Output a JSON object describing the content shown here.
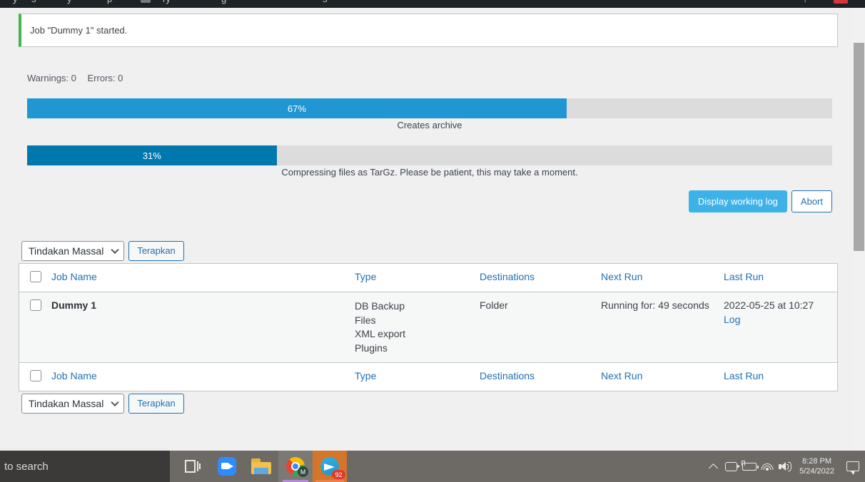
{
  "adminbar": {
    "items": [
      "y",
      "s",
      "y",
      "p",
      "A",
      "ry",
      "g",
      "s",
      "t"
    ],
    "right_item": "?"
  },
  "notice": {
    "message": "Job \"Dummy 1\" started.",
    "accent_color": "#46b450"
  },
  "status": {
    "warnings_label": "Warnings: 0",
    "errors_label": "Errors: 0"
  },
  "progress": {
    "bars": [
      {
        "percent_label": "67%",
        "percent": 67,
        "caption": "Creates archive",
        "color": "#2096d2"
      },
      {
        "percent_label": "31%",
        "percent": 31,
        "caption": "Compressing files as TarGz. Please be patient, this may take a moment.",
        "color": "#0178ad"
      }
    ]
  },
  "actions": {
    "display_log_label": "Display working log",
    "abort_label": "Abort",
    "primary_color": "#3db2e8",
    "secondary_color": "#2271b1"
  },
  "bulk": {
    "select_value": "Tindakan Massal",
    "apply_label": "Terapkan"
  },
  "table": {
    "columns": [
      "Job Name",
      "Type",
      "Destinations",
      "Next Run",
      "Last Run"
    ],
    "rows": [
      {
        "name": "Dummy 1",
        "types": [
          "DB Backup",
          "Files",
          "XML export",
          "Plugins"
        ],
        "destinations": "Folder",
        "next_run": "Running for: 49 seconds",
        "last_run": "2022-05-25 at 10:27",
        "log_label": "Log"
      }
    ]
  },
  "taskbar": {
    "search_text": "to search",
    "apps": [
      {
        "name": "task-view",
        "badge": ""
      },
      {
        "name": "zoom",
        "badge": ""
      },
      {
        "name": "file-explorer",
        "badge": ""
      },
      {
        "name": "chrome",
        "badge": "M"
      },
      {
        "name": "telegram",
        "badge": "92"
      }
    ],
    "chrome_badge": "M",
    "telegram_badge": "92",
    "clock_time": "8:28 PM",
    "clock_date": "5/24/2022"
  }
}
